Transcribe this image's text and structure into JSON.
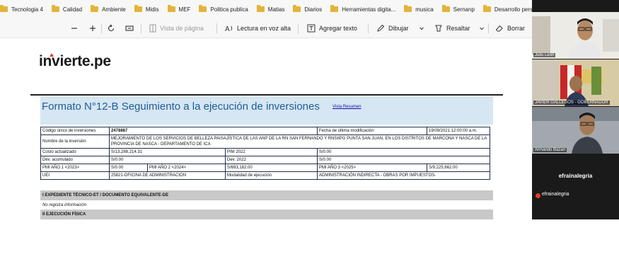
{
  "bookmarks": [
    {
      "label": "Tecnologia 4"
    },
    {
      "label": "Calidad"
    },
    {
      "label": "Ambiente"
    },
    {
      "label": "Midis"
    },
    {
      "label": "MEF"
    },
    {
      "label": "Politica publica"
    },
    {
      "label": "Matias"
    },
    {
      "label": "Diarios"
    },
    {
      "label": "Herramientas digita..."
    },
    {
      "label": "musica"
    },
    {
      "label": "Sernanp"
    },
    {
      "label": "Desarrollo personal"
    }
  ],
  "toolbar": {
    "zoom_out_icon": "minus-icon",
    "zoom_in_icon": "plus-icon",
    "rotate_icon": "rotate-icon",
    "fit_icon": "fit-page-icon",
    "page_view": "Vista de página",
    "read_aloud": "Lectura en voz alta",
    "add_text": "Agregar texto",
    "draw": "Dibujar",
    "highlight": "Resaltar",
    "erase": "Borrar"
  },
  "document": {
    "logo": "invierte.pe",
    "title": "Formato N°12-B Seguimiento a la ejecución de inversiones",
    "summary_link": "Vista Resumen",
    "rows": [
      {
        "c1": "Código único de inversiones",
        "c2": "2478887",
        "c3": "Fecha de última modificación",
        "c4": "19/09/2021 12:00:00 a.m."
      },
      {
        "c1": "Nombre de la inversión",
        "c2": "MEJORAMIENTO DE LOS SERVICIOS DE BELLEZA PAISAJÍSTICA DE LAS ANP DE LA RN SAN FERNANDO Y RNSIIPG PUNTA SAN JUAN, EN LOS DISTRITOS DE MARCONA Y NASCA DE LA PROVINCIA DE NASCA - DEPARTAMENTO DE ICA"
      },
      {
        "c1": "Costo actualizado",
        "c2": "S/13,288,214.31",
        "c3": "PIM 2022",
        "c4": "S/0.00"
      },
      {
        "c1": "Dev. acumulado",
        "c2": "S/0.00",
        "c3": "Dev. 2022",
        "c4": "S/0.00"
      },
      {
        "c1": "PMI AÑO 1 <2023>",
        "c2": "S/0.00",
        "c3": "PMI AÑO 2 <2024>",
        "c4": "S/693,182.00",
        "c5": "PMI AÑO 3 <2025>",
        "c6": "S/9,225,662.00"
      },
      {
        "c1": "UEI",
        "c2": "25821-OFICINA DE ADMINISTRACION",
        "c3": "Modalidad de ejecución",
        "c4": "ADMINISTRACIÓN INDIRECTA - OBRAS POR IMPUESTOS-"
      }
    ],
    "section1": "I EXPEDIENTE TÉCNICO-ET / DOCUMENTO EQUIVALENTE-DE",
    "section1_note": "No registra información",
    "section2": "II EJECUCIÓN FÍSICA"
  },
  "video": {
    "participants": [
      {
        "name": "Julio Leon"
      },
      {
        "name": "JAVIER GALLEGOS - GOBERNADOR"
      },
      {
        "name": "Armando Bazan"
      }
    ],
    "center_name": "efrainalegria",
    "footer_name": "efrainalegria"
  }
}
